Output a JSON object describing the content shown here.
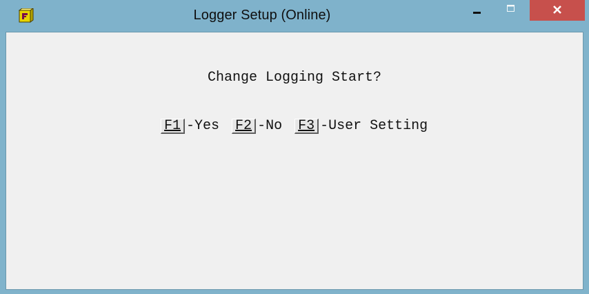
{
  "window": {
    "title": "Logger Setup (Online)",
    "icon": "logger-app-icon",
    "controls": {
      "minimize": "minimize-icon",
      "maximize": "maximize-icon",
      "close": "close-icon"
    }
  },
  "dialog": {
    "prompt": "Change Logging Start?",
    "options": [
      {
        "key": "F1",
        "label": "-Yes"
      },
      {
        "key": "F2",
        "label": "-No"
      },
      {
        "key": "F3",
        "label": "-User Setting"
      }
    ]
  },
  "colors": {
    "titlebar": "#7fb2cb",
    "close_button": "#c7504c",
    "client_background": "#f0f0f0"
  }
}
